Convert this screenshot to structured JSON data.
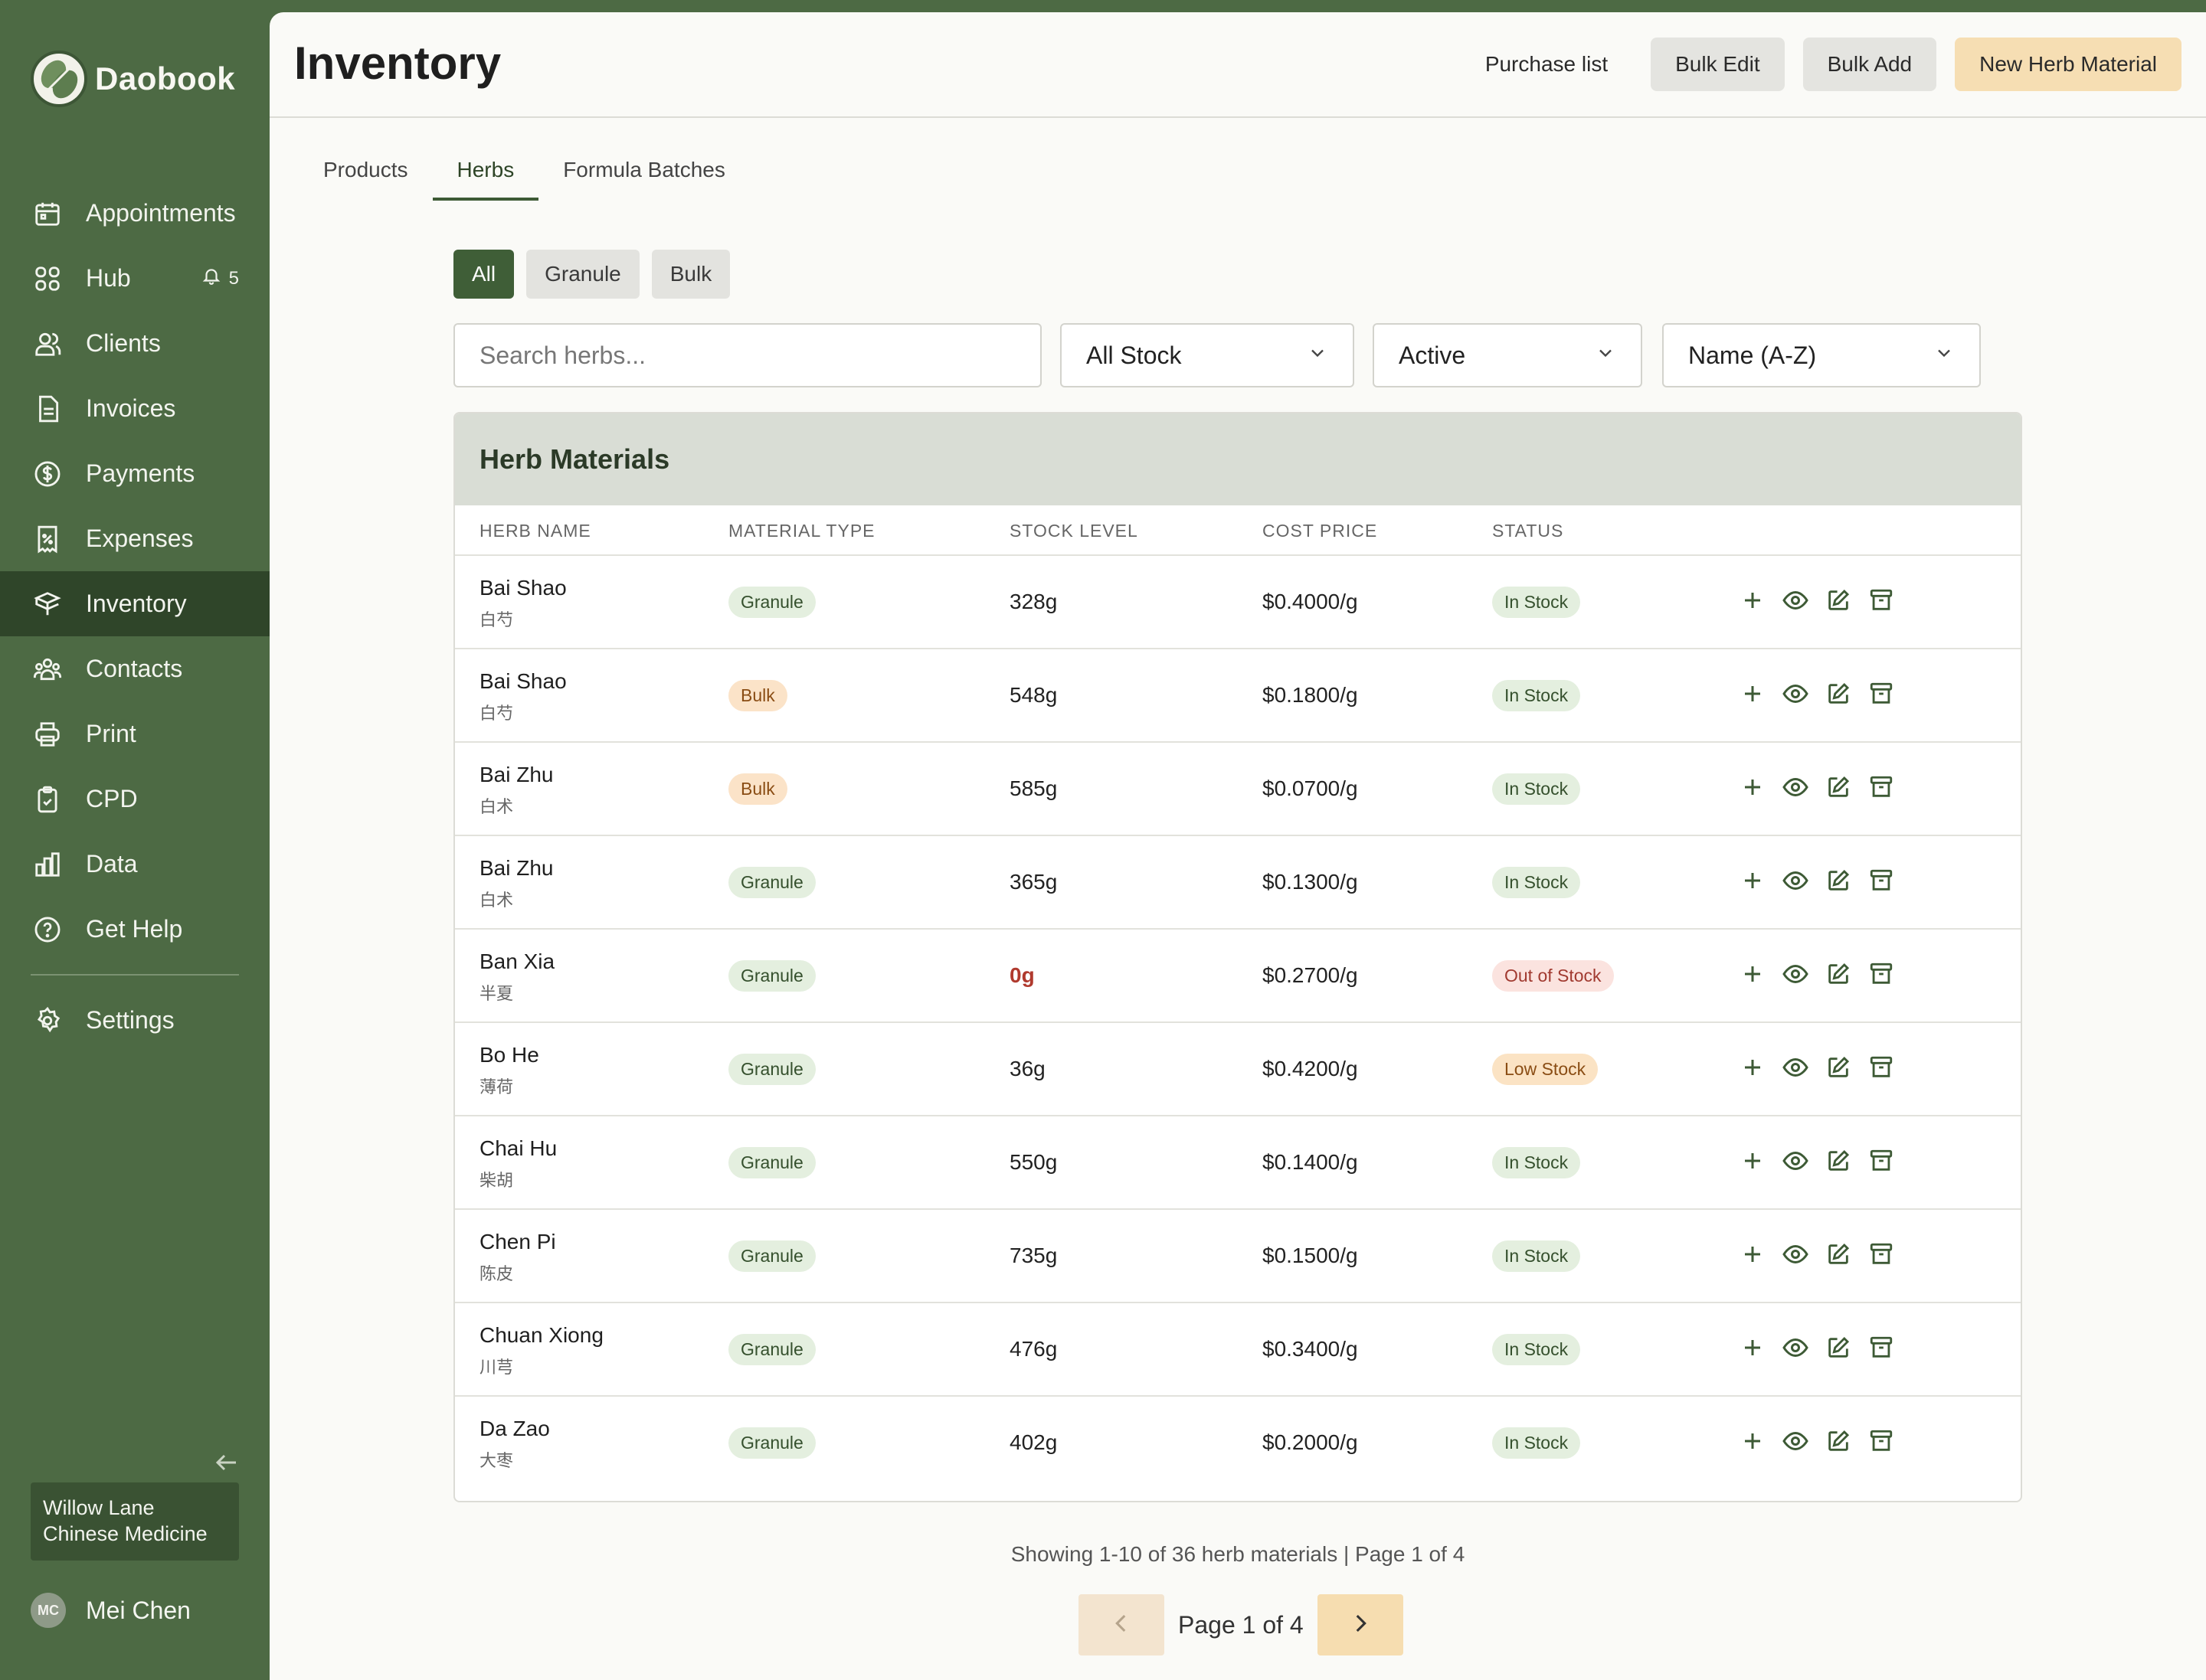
{
  "brand": {
    "name": "Daobook"
  },
  "sidebar": {
    "items": [
      {
        "label": "Appointments",
        "icon": "calendar-icon"
      },
      {
        "label": "Hub",
        "icon": "grid-icon",
        "badge": "5"
      },
      {
        "label": "Clients",
        "icon": "users-icon"
      },
      {
        "label": "Invoices",
        "icon": "document-icon"
      },
      {
        "label": "Payments",
        "icon": "dollar-circle-icon"
      },
      {
        "label": "Expenses",
        "icon": "receipt-icon"
      },
      {
        "label": "Inventory",
        "icon": "box-icon",
        "active": true
      },
      {
        "label": "Contacts",
        "icon": "contacts-icon"
      },
      {
        "label": "Print",
        "icon": "printer-icon"
      },
      {
        "label": "CPD",
        "icon": "clipboard-check-icon"
      },
      {
        "label": "Data",
        "icon": "bar-chart-icon"
      },
      {
        "label": "Get Help",
        "icon": "help-circle-icon"
      }
    ],
    "settings": "Settings",
    "clinic": "Willow Lane Chinese Medicine",
    "user": {
      "initials": "MC",
      "name": "Mei Chen"
    }
  },
  "header": {
    "title": "Inventory",
    "purchase_list": "Purchase list",
    "bulk_edit": "Bulk Edit",
    "bulk_add": "Bulk Add",
    "new_herb": "New Herb Material"
  },
  "tabs": [
    "Products",
    "Herbs",
    "Formula Batches"
  ],
  "type_filter": [
    "All",
    "Granule",
    "Bulk"
  ],
  "filters": {
    "search_placeholder": "Search herbs...",
    "stock": "All Stock",
    "status": "Active",
    "sort": "Name (A-Z)"
  },
  "table": {
    "title": "Herb Materials",
    "columns": [
      "HERB NAME",
      "MATERIAL TYPE",
      "STOCK LEVEL",
      "COST PRICE",
      "STATUS"
    ],
    "rows": [
      {
        "name": "Bai Shao",
        "cn": "白芍",
        "type": "Granule",
        "stock": "328g",
        "cost": "$0.4000/g",
        "status": "In Stock"
      },
      {
        "name": "Bai Shao",
        "cn": "白芍",
        "type": "Bulk",
        "stock": "548g",
        "cost": "$0.1800/g",
        "status": "In Stock"
      },
      {
        "name": "Bai Zhu",
        "cn": "白术",
        "type": "Bulk",
        "stock": "585g",
        "cost": "$0.0700/g",
        "status": "In Stock"
      },
      {
        "name": "Bai Zhu",
        "cn": "白术",
        "type": "Granule",
        "stock": "365g",
        "cost": "$0.1300/g",
        "status": "In Stock"
      },
      {
        "name": "Ban Xia",
        "cn": "半夏",
        "type": "Granule",
        "stock": "0g",
        "cost": "$0.2700/g",
        "status": "Out of Stock"
      },
      {
        "name": "Bo He",
        "cn": "薄荷",
        "type": "Granule",
        "stock": "36g",
        "cost": "$0.4200/g",
        "status": "Low Stock"
      },
      {
        "name": "Chai Hu",
        "cn": "柴胡",
        "type": "Granule",
        "stock": "550g",
        "cost": "$0.1400/g",
        "status": "In Stock"
      },
      {
        "name": "Chen Pi",
        "cn": "陈皮",
        "type": "Granule",
        "stock": "735g",
        "cost": "$0.1500/g",
        "status": "In Stock"
      },
      {
        "name": "Chuan Xiong",
        "cn": "川芎",
        "type": "Granule",
        "stock": "476g",
        "cost": "$0.3400/g",
        "status": "In Stock"
      },
      {
        "name": "Da Zao",
        "cn": "大枣",
        "type": "Granule",
        "stock": "402g",
        "cost": "$0.2000/g",
        "status": "In Stock"
      }
    ]
  },
  "pagination": {
    "summary": "Showing 1-10 of 36 herb materials | Page 1 of 4",
    "label": "Page 1 of 4"
  },
  "colors": {
    "sidebar": "#4d6a44",
    "sidebar_active": "#2f4529",
    "accent": "#f6deb3",
    "chip_active": "#3f5e37"
  }
}
